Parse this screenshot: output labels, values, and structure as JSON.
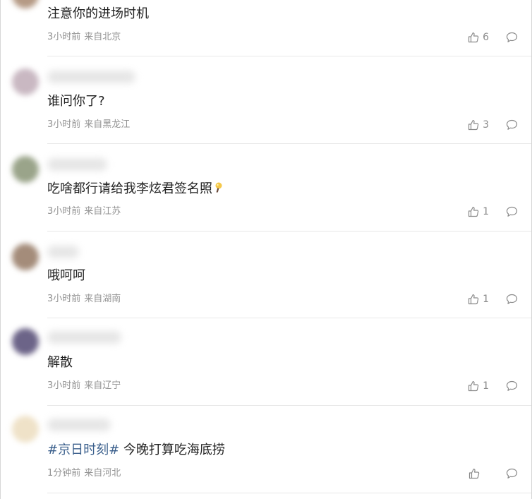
{
  "comments": [
    {
      "text": "注意你的进场时机",
      "time": "3小时前",
      "location": "来自北京",
      "likes": "6",
      "avatar_color": "#b59a85"
    },
    {
      "text": "谁问你了?",
      "time": "3小时前",
      "location": "来自黑龙江",
      "likes": "3",
      "avatar_color": "#c9b8c2"
    },
    {
      "text": "吃啥都行请给我李炫君签名照",
      "time": "3小时前",
      "location": "来自江苏",
      "likes": "1",
      "avatar_color": "#9aa48a",
      "trailing_icon": "light-bulb-emoji"
    },
    {
      "text": "哦呵呵",
      "time": "3小时前",
      "location": "来自湖南",
      "likes": "1",
      "avatar_color": "#a48c7a"
    },
    {
      "text": "解散",
      "time": "3小时前",
      "location": "来自辽宁",
      "likes": "1",
      "avatar_color": "#6c6488"
    },
    {
      "hashtag": "#京日时刻#",
      "text": " 今晚打算吃海底捞",
      "time": "1分钟前",
      "location": "来自河北",
      "likes": "",
      "avatar_color": "#efe2c8"
    }
  ],
  "icons": {
    "like": "thumbs-up-icon",
    "reply": "comment-bubble-icon"
  },
  "colors": {
    "hashtag": "#3a5f8c",
    "meta_text": "#939393",
    "divider": "#e8e8e8"
  }
}
